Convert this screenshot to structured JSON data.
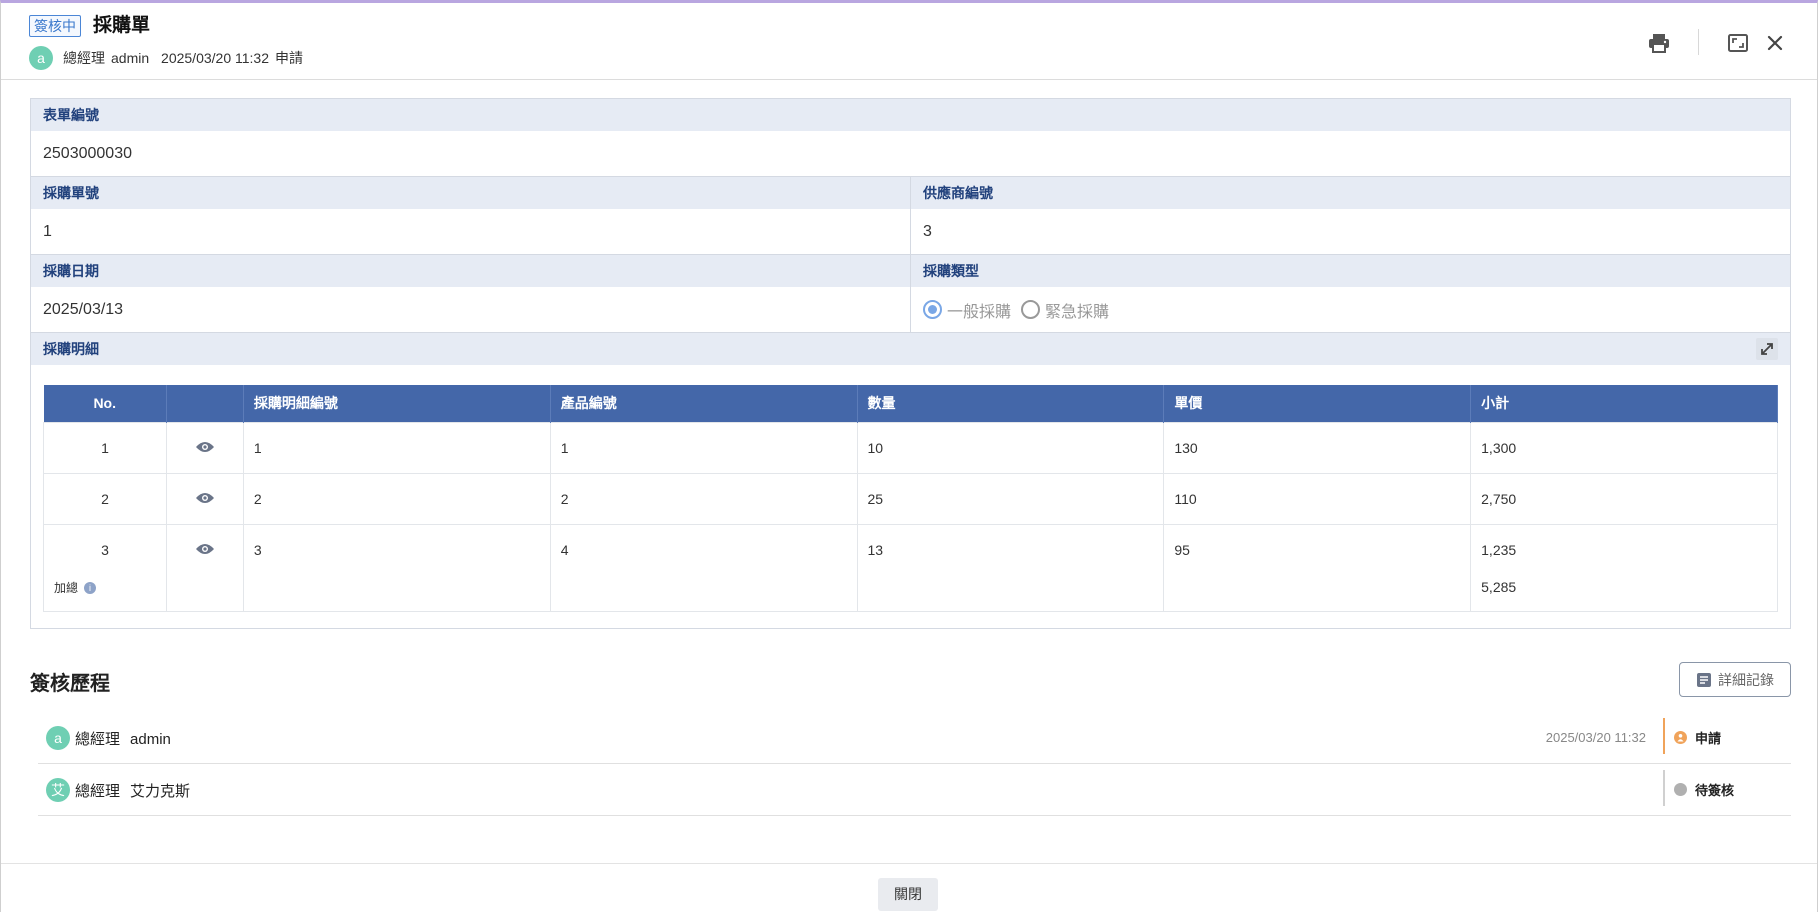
{
  "header": {
    "status_tag": "簽核中",
    "title": "採購單",
    "avatar_letter": "a",
    "applicant_role": "總經理",
    "applicant_name": "admin",
    "datetime": "2025/03/20 11:32",
    "action": "申請",
    "icons": [
      "printer-icon",
      "fullscreen-icon",
      "close-icon"
    ]
  },
  "form": {
    "form_no_label": "表單編號",
    "form_no_value": "2503000030",
    "po_no_label": "採購單號",
    "po_no_value": "1",
    "supplier_no_label": "供應商編號",
    "supplier_no_value": "3",
    "po_date_label": "採購日期",
    "po_date_value": "2025/03/13",
    "po_type_label": "採購類型",
    "po_type_options": [
      "一般採購",
      "緊急採購"
    ],
    "po_type_selected": "一般採購",
    "detail_label": "採購明細"
  },
  "detail_table": {
    "headers": [
      "No.",
      "",
      "採購明細編號",
      "產品編號",
      "數量",
      "單價",
      "小計"
    ],
    "rows": [
      {
        "no": "1",
        "detail_no": "1",
        "product_no": "1",
        "qty": "10",
        "price": "130",
        "subtotal": "1,300"
      },
      {
        "no": "2",
        "detail_no": "2",
        "product_no": "2",
        "qty": "25",
        "price": "110",
        "subtotal": "2,750"
      },
      {
        "no": "3",
        "detail_no": "3",
        "product_no": "4",
        "qty": "13",
        "price": "95",
        "subtotal": "1,235"
      }
    ],
    "sum_label": "加總",
    "sum_value": "5,285"
  },
  "history": {
    "title": "簽核歷程",
    "detail_button": "詳細記錄",
    "entries": [
      {
        "avatar": "a",
        "role": "總經理",
        "name": "admin",
        "time": "2025/03/20 11:32",
        "status": "申請",
        "status_color": "#f0a35a"
      },
      {
        "avatar": "艾",
        "role": "總經理",
        "name": "艾力克斯",
        "time": "",
        "status": "待簽核",
        "status_color": "#b0b0b0"
      }
    ]
  },
  "footer": {
    "close_button": "關閉"
  },
  "colors": {
    "accent": "#4467a9",
    "label_bg": "#e6ebf4",
    "avatar": "#6fcfb3",
    "tag": "#3a78cc"
  }
}
